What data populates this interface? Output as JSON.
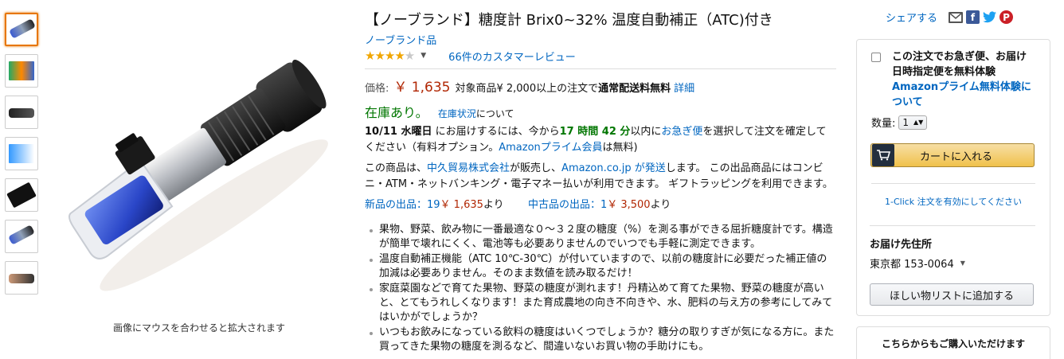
{
  "gallery": {
    "thumbnail_count": 7,
    "zoom_hint": "画像にマウスを合わせると拡大されます"
  },
  "product": {
    "title": "【ノーブランド】糖度計 Brix0~32% 温度自動補正（ATC)付き",
    "brand": "ノーブランド品",
    "rating": 4,
    "reviews_link": "66件のカスタマーレビュー"
  },
  "price": {
    "label": "価格:",
    "amount": "￥ 1,635",
    "shipping_pre": "対象商品¥ 2,000以上の注文で",
    "shipping_bold": "通常配送料無料",
    "details_link": "詳細"
  },
  "stock": {
    "status": "在庫あり。",
    "status_link": "在庫状況",
    "status_suffix": "について"
  },
  "delivery_msg": {
    "date": "10/11 水曜日",
    "part1": "にお届けするには、今から",
    "countdown": "17 時間 42 分",
    "part2": "以内に",
    "express_link": "お急ぎ便",
    "part3": "を選択して注文を確定してください（有料オプション。",
    "prime_link": "Amazonプライム会員",
    "part4": "は無料)"
  },
  "seller_msg": {
    "part1": "この商品は、",
    "seller_link": "中久貿易株式会社",
    "part2": "が販売し、",
    "amazon_link": "Amazon.co.jp が発送",
    "part3": "します。 この出品商品にはコンビニ・ATM・ネットバンキング・電子マネー払いが利用できます。 ギフトラッピングを利用できます。"
  },
  "offers": {
    "new_label": "新品の出品：19",
    "new_price": "￥ 1,635",
    "new_suffix": "より",
    "used_label": "中古品の出品：1",
    "used_price": "￥ 3,500",
    "used_suffix": "より"
  },
  "bullets": [
    "果物、野菜、飲み物に一番最適な０～３２度の糖度（%）を測る事ができる屈折糖度計です。構造が簡単で壊れにくく、電池等も必要ありませんのでいつでも手軽に測定できます。",
    "温度自動補正機能（ATC 10℃-30℃）が付いていますので、以前の糖度計に必要だった補正値の加減は必要ありません。そのまま数値を読み取るだけ！",
    "家庭菜園などで育てた果物、野菜の糖度が測れます！丹精込めて育てた果物、野菜の糖度が高いと、とてもうれしくなります！また育成農地の向き不向きや、水、肥料の与え方の参考にしてみてはいかがでしょうか？",
    "いつもお飲みになっている飲料の糖度はいくつでしょうか？糖分の取りすぎが気になる方に。また買ってきた果物の糖度を測るなど、間違いないお買い物の手助けにも。"
  ],
  "share": {
    "label": "シェアする",
    "icons": [
      "mail-icon",
      "facebook-icon",
      "twitter-icon",
      "pinterest-icon"
    ]
  },
  "buybox": {
    "express_text": "この注文でお急ぎ便、お届け日時指定便を無料体験",
    "prime_trial_link": "Amazonプライム無料体験について",
    "qty_label": "数量:",
    "qty_value": "1",
    "cart_button": "カートに入れる",
    "oneclick_link": "1-Click 注文を有効にしてください",
    "deliver_heading": "お届け先住所",
    "address": "東京都 153-0064",
    "wishlist_button": "ほしい物リストに追加する"
  },
  "other_sellers": {
    "heading": "こちらからもご購入いただけます"
  },
  "colors": {
    "link": "#0066c0",
    "price": "#b12704",
    "instock": "#007600",
    "star": "#f0a500",
    "cart_button": "#f0c14b"
  }
}
